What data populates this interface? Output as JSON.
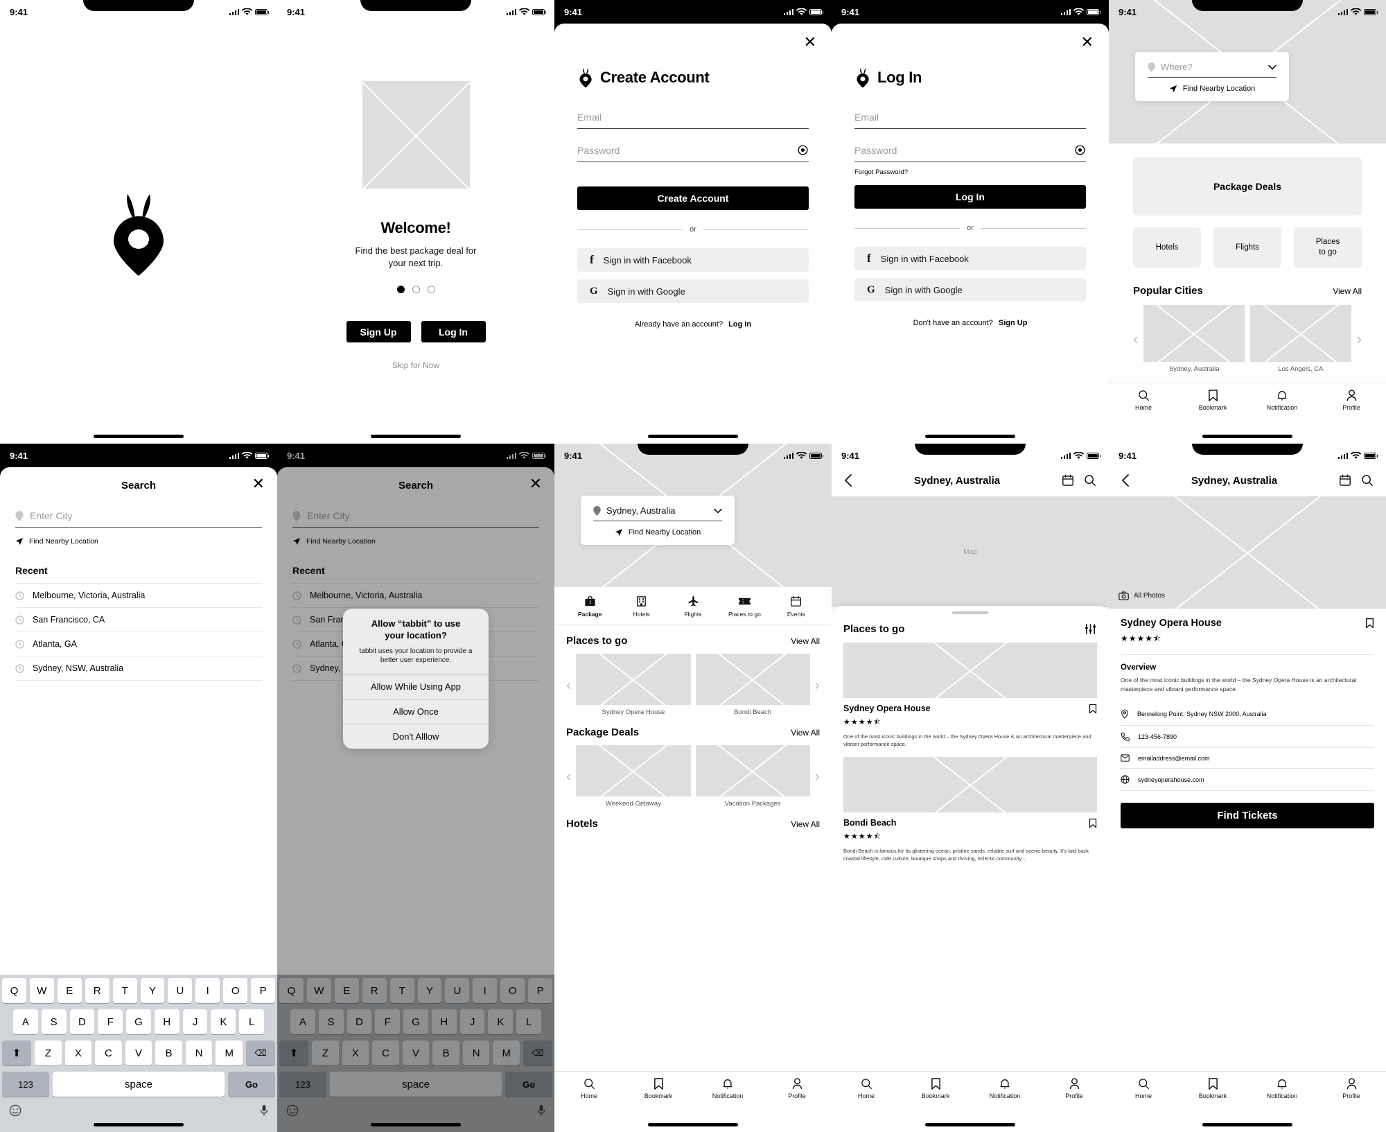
{
  "app": {
    "name": "tabbit",
    "status_time": "9:41"
  },
  "screen1_splash": {
    "name": "Splash"
  },
  "screen2_welcome": {
    "title": "Welcome!",
    "subtitle_line1": "Find the best package deal for",
    "subtitle_line2": "your next trip.",
    "dots": [
      true,
      false,
      false
    ],
    "signup_label": "Sign Up",
    "login_label": "Log In",
    "skip_label": "Skip for Now"
  },
  "screen3_create": {
    "title": "Create Account",
    "email_placeholder": "Email",
    "password_placeholder": "Password",
    "primary_button": "Create Account",
    "or_label": "or",
    "facebook_label": "Sign in with Facebook",
    "google_label": "Sign in with Google",
    "footer_text": "Already have an account?",
    "footer_link": "Log In"
  },
  "screen4_login": {
    "title": "Log In",
    "email_placeholder": "Email",
    "password_placeholder": "Password",
    "forgot_label": "Forgot Password?",
    "primary_button": "Log In",
    "or_label": "or",
    "facebook_label": "Sign in with Facebook",
    "google_label": "Sign in with Google",
    "footer_text": "Don't have an account?",
    "footer_link": "Sign Up"
  },
  "screen5_home": {
    "where_placeholder": "Where?",
    "find_nearby": "Find Nearby Location",
    "package_deals": "Package Deals",
    "categories": [
      "Hotels",
      "Flights",
      "Places\nto go"
    ],
    "popular_cities_title": "Popular Cities",
    "view_all": "View All",
    "cities": [
      "Sydney, Australia",
      "Los Angels, CA"
    ],
    "nav": [
      "Home",
      "Bookmark",
      "Notification",
      "Profile"
    ]
  },
  "screen6_search": {
    "title": "Search",
    "city_placeholder": "Enter City",
    "find_nearby": "Find Nearby Location",
    "recent_label": "Recent",
    "recent_items": [
      "Melbourne, Victoria, Australia",
      "San Francisco, CA",
      "Atlanta, GA",
      "Sydney, NSW, Australia"
    ],
    "keyboard": {
      "row1": [
        "Q",
        "W",
        "E",
        "R",
        "T",
        "Y",
        "U",
        "I",
        "O",
        "P"
      ],
      "row2": [
        "A",
        "S",
        "D",
        "F",
        "G",
        "H",
        "J",
        "K",
        "L"
      ],
      "row3": [
        "Z",
        "X",
        "C",
        "V",
        "B",
        "N",
        "M"
      ],
      "num": "123",
      "space": "space",
      "go": "Go"
    }
  },
  "screen7_permission": {
    "title": "Search",
    "city_placeholder": "Enter City",
    "find_nearby": "Find Nearby Location",
    "recent_label": "Recent",
    "recent_items": [
      "Melbourne, Victoria, Australia",
      "San Francisco, CA",
      "Atlanta, GA",
      "Sydney, NSW, Australia"
    ],
    "alert": {
      "title_line1": "Allow “tabbit” to use",
      "title_line2": "your location?",
      "message_line1": "tabbit uses your location to provide a",
      "message_line2": "better user experience.",
      "buttons": [
        "Allow While Using App",
        "Allow Once",
        "Don't Alllow"
      ]
    }
  },
  "screen8_explore": {
    "location_value": "Sydney, Australia",
    "find_nearby": "Find Nearby Location",
    "tabs": [
      "Package",
      "Hotels",
      "Flights",
      "Places to go",
      "Events"
    ],
    "sections": [
      {
        "title": "Places to go",
        "view_all": "View All",
        "cards": [
          "Sydney Opera House",
          "Bondi Beach"
        ]
      },
      {
        "title": "Package Deals",
        "view_all": "View All",
        "cards": [
          "Weekend Getaway",
          "Vacation Packages"
        ]
      },
      {
        "title": "Hotels",
        "view_all": "View All",
        "cards": []
      }
    ],
    "nav": [
      "Home",
      "Bookmark",
      "Notification",
      "Profile"
    ]
  },
  "screen9_map": {
    "header_title": "Sydney, Australia",
    "map_label": "Map",
    "sheet_title": "Places to go",
    "items": [
      {
        "name": "Sydney Opera House",
        "rating": 4.5,
        "stars": "★★★★⯪",
        "description": "One of the most iconic buildings in the world – the Sydney Opera House is an architectural masterpiece and vibrant performance space."
      },
      {
        "name": "Bondi Beach",
        "rating": 4.5,
        "stars": "★★★★⯪",
        "description": "Bondi Beach is famous for its glistening ocean, pristine sands, reliable surf and scenic beauty. It's laid back coastal lifestyle, cafe culture, boutique shops and thriving, eclectic community..."
      }
    ],
    "nav": [
      "Home",
      "Bookmark",
      "Notification",
      "Profile"
    ]
  },
  "screen10_detail": {
    "header_title": "Sydney, Australia",
    "all_photos": "All Photos",
    "place_name": "Sydney Opera House",
    "stars": "★★★★⯪",
    "overview_label": "Overview",
    "overview_text": "One of the most iconic buildings in the world – the Sydney Opera House is an architectural masterpiece and vibrant performance space.",
    "address": "Bennelong Point, Sydney NSW 2000, Australia",
    "phone": "123-456-7890",
    "email": "emailaddress@email.com",
    "website": "sydneyoperahouse.com",
    "cta": "Find Tickets",
    "nav": [
      "Home",
      "Bookmark",
      "Notification",
      "Profile"
    ]
  },
  "colors": {
    "accent": "#000000",
    "placeholder_gray": "#dedede",
    "surface_gray": "#efefef",
    "muted_text": "#8c8c8c"
  }
}
